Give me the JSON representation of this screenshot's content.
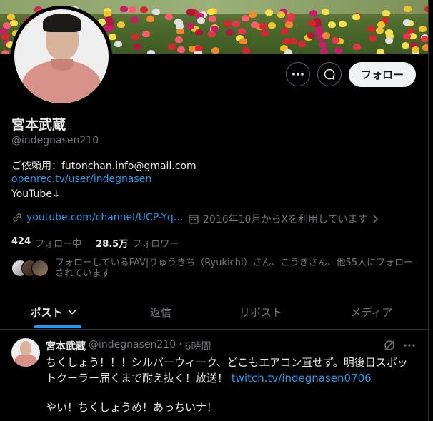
{
  "profile": {
    "name": "宮本武蔵",
    "handle": "@indegnasen210",
    "bio_line1": "ご依頼用：futonchan.info@gmail.com",
    "bio_link": "openrec.tv/user/indegnasen",
    "bio_line3": "YouTube↓",
    "website": "youtube.com/channel/UCP-Yq...",
    "joined": "2016年10月からXを利用しています",
    "following_count": "424",
    "following_label": "フォロー中",
    "followers_count": "28.5万",
    "followers_label": "フォロワー",
    "followed_by": "フォローしているFAV|りゅうきち（Ryukichi）さん、こうきさん、他55人にフォローされています"
  },
  "actions": {
    "more_icon": "more-horizontal-icon",
    "message_icon": "message-icon",
    "follow_label": "フォロー"
  },
  "tabs": [
    {
      "label": "ポスト",
      "active": true
    },
    {
      "label": "返信",
      "active": false
    },
    {
      "label": "リポスト",
      "active": false
    },
    {
      "label": "メディア",
      "active": false
    }
  ],
  "post": {
    "author_name": "宮本武蔵",
    "author_handle": "@indegnasen210",
    "separator": "·",
    "time": "6時間",
    "text_main": "ちくしょう！！！シルバーウィーク、どこもエアコン直せず。明後日スポットクーラー届くまで耐え抜く！放送！",
    "text_link": "twitch.tv/indegnasen0706",
    "text_second": "やい！ちくしょうめ！あっちいナ！"
  },
  "colors": {
    "accent": "#1d9bf0",
    "background": "#000000",
    "muted": "#71767b",
    "text": "#e7e9ea"
  }
}
